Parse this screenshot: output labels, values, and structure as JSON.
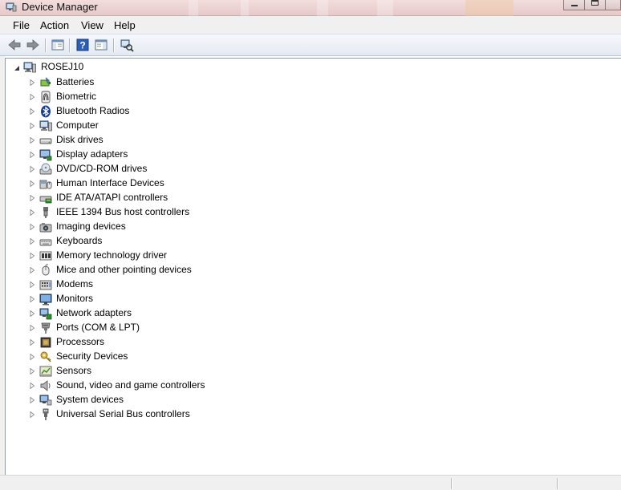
{
  "window": {
    "title": "Device Manager"
  },
  "menubar": {
    "items": [
      {
        "label": "File"
      },
      {
        "label": "Action"
      },
      {
        "label": "View"
      },
      {
        "label": "Help"
      }
    ],
    "highlight_color": "#f4f52a"
  },
  "toolbar": {
    "buttons": [
      {
        "name": "back-arrow-icon"
      },
      {
        "name": "forward-arrow-icon"
      },
      {
        "name": "show-hide-console-tree-icon"
      },
      {
        "name": "help-icon"
      },
      {
        "name": "properties-pane-icon"
      },
      {
        "name": "scan-hardware-icon"
      }
    ]
  },
  "tree": {
    "root": {
      "label": "ROSEJ10",
      "expanded": true,
      "icon": "computer-icon"
    },
    "items": [
      {
        "label": "Batteries",
        "icon": "battery-icon"
      },
      {
        "label": "Biometric",
        "icon": "fingerprint-icon"
      },
      {
        "label": "Bluetooth Radios",
        "icon": "bluetooth-icon"
      },
      {
        "label": "Computer",
        "icon": "computer-icon"
      },
      {
        "label": "Disk drives",
        "icon": "disk-drive-icon"
      },
      {
        "label": "Display adapters",
        "icon": "display-adapter-icon"
      },
      {
        "label": "DVD/CD-ROM drives",
        "icon": "dvd-drive-icon"
      },
      {
        "label": "Human Interface Devices",
        "icon": "hid-icon"
      },
      {
        "label": "IDE ATA/ATAPI controllers",
        "icon": "ide-controller-icon"
      },
      {
        "label": "IEEE 1394 Bus host controllers",
        "icon": "firewire-icon"
      },
      {
        "label": "Imaging devices",
        "icon": "camera-icon"
      },
      {
        "label": "Keyboards",
        "icon": "keyboard-icon"
      },
      {
        "label": "Memory technology driver",
        "icon": "memory-icon"
      },
      {
        "label": "Mice and other pointing devices",
        "icon": "mouse-icon"
      },
      {
        "label": "Modems",
        "icon": "modem-icon"
      },
      {
        "label": "Monitors",
        "icon": "monitor-icon"
      },
      {
        "label": "Network adapters",
        "icon": "network-adapter-icon"
      },
      {
        "label": "Ports (COM & LPT)",
        "icon": "port-icon"
      },
      {
        "label": "Processors",
        "icon": "processor-icon"
      },
      {
        "label": "Security Devices",
        "icon": "security-key-icon"
      },
      {
        "label": "Sensors",
        "icon": "sensor-icon"
      },
      {
        "label": "Sound, video and game controllers",
        "icon": "speaker-icon"
      },
      {
        "label": "System devices",
        "icon": "system-device-icon"
      },
      {
        "label": "Universal Serial Bus controllers",
        "icon": "usb-icon"
      }
    ]
  }
}
